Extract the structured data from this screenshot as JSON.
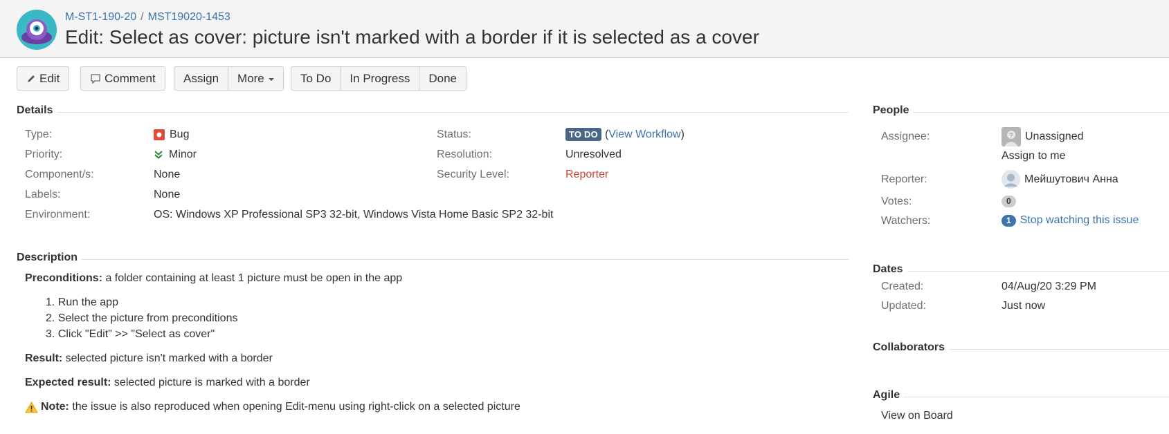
{
  "header": {
    "project_key": "M-ST1-190-20",
    "separator": "/",
    "issue_key": "MST19020-1453",
    "title": "Edit: Select as cover: picture isn't marked with a border if it is selected as a cover"
  },
  "toolbar": {
    "edit": "Edit",
    "comment": "Comment",
    "assign": "Assign",
    "more": "More",
    "todo": "To Do",
    "in_progress": "In Progress",
    "done": "Done"
  },
  "details": {
    "heading": "Details",
    "type_label": "Type:",
    "type_value": "Bug",
    "priority_label": "Priority:",
    "priority_value": "Minor",
    "components_label": "Component/s:",
    "components_value": "None",
    "labels_label": "Labels:",
    "labels_value": "None",
    "environment_label": "Environment:",
    "environment_value": "OS: Windows XP Professional SP3 32-bit, Windows Vista Home Basic SP2 32-bit",
    "status_label": "Status:",
    "status_value": "TO DO",
    "status_paren_open": "(",
    "view_workflow": "View Workflow",
    "status_paren_close": ")",
    "resolution_label": "Resolution:",
    "resolution_value": "Unresolved",
    "security_label": "Security Level:",
    "security_value": "Reporter"
  },
  "description": {
    "heading": "Description",
    "preconditions_label": "Preconditions:",
    "preconditions_text": " a folder containing at least 1 picture must be open in the app",
    "steps": [
      "1. Run the app",
      "2. Select the picture from preconditions",
      "3. Click \"Edit\" >> \"Select as cover\""
    ],
    "result_label": "Result:",
    "result_text": " selected picture isn't marked with a border",
    "expected_label": "Expected result:",
    "expected_text": " selected picture is marked with a border",
    "note_label": "Note:",
    "note_text": " the issue is also reproduced when opening Edit-menu using right-click on a selected picture"
  },
  "people": {
    "heading": "People",
    "assignee_label": "Assignee:",
    "assignee_value": "Unassigned",
    "assign_to_me": "Assign to me",
    "reporter_label": "Reporter:",
    "reporter_value": "Мейшутович Анна",
    "votes_label": "Votes:",
    "votes_value": "0",
    "watchers_label": "Watchers:",
    "watchers_count": "1",
    "watchers_action": "Stop watching this issue"
  },
  "dates": {
    "heading": "Dates",
    "created_label": "Created:",
    "created_value": "04/Aug/20 3:29 PM",
    "updated_label": "Updated:",
    "updated_value": "Just now"
  },
  "collaborators": {
    "heading": "Collaborators"
  },
  "agile": {
    "heading": "Agile",
    "view_on_board": "View on Board"
  },
  "colors": {
    "link": "#3b73af",
    "status_lozenge": "#4a6785",
    "security_red": "#d04437",
    "bug_red": "#e5493a"
  }
}
